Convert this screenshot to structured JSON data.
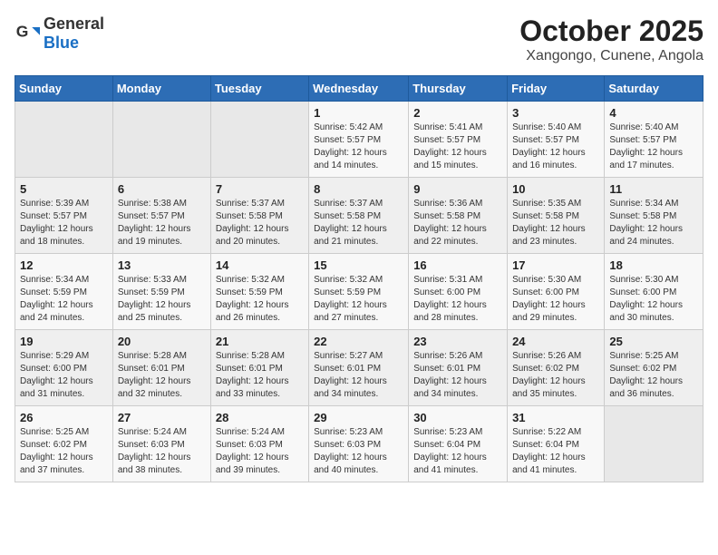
{
  "logo": {
    "general": "General",
    "blue": "Blue"
  },
  "title": {
    "month": "October 2025",
    "location": "Xangongo, Cunene, Angola"
  },
  "weekdays": [
    "Sunday",
    "Monday",
    "Tuesday",
    "Wednesday",
    "Thursday",
    "Friday",
    "Saturday"
  ],
  "weeks": [
    [
      {
        "day": "",
        "info": ""
      },
      {
        "day": "",
        "info": ""
      },
      {
        "day": "",
        "info": ""
      },
      {
        "day": "1",
        "info": "Sunrise: 5:42 AM\nSunset: 5:57 PM\nDaylight: 12 hours\nand 14 minutes."
      },
      {
        "day": "2",
        "info": "Sunrise: 5:41 AM\nSunset: 5:57 PM\nDaylight: 12 hours\nand 15 minutes."
      },
      {
        "day": "3",
        "info": "Sunrise: 5:40 AM\nSunset: 5:57 PM\nDaylight: 12 hours\nand 16 minutes."
      },
      {
        "day": "4",
        "info": "Sunrise: 5:40 AM\nSunset: 5:57 PM\nDaylight: 12 hours\nand 17 minutes."
      }
    ],
    [
      {
        "day": "5",
        "info": "Sunrise: 5:39 AM\nSunset: 5:57 PM\nDaylight: 12 hours\nand 18 minutes."
      },
      {
        "day": "6",
        "info": "Sunrise: 5:38 AM\nSunset: 5:57 PM\nDaylight: 12 hours\nand 19 minutes."
      },
      {
        "day": "7",
        "info": "Sunrise: 5:37 AM\nSunset: 5:58 PM\nDaylight: 12 hours\nand 20 minutes."
      },
      {
        "day": "8",
        "info": "Sunrise: 5:37 AM\nSunset: 5:58 PM\nDaylight: 12 hours\nand 21 minutes."
      },
      {
        "day": "9",
        "info": "Sunrise: 5:36 AM\nSunset: 5:58 PM\nDaylight: 12 hours\nand 22 minutes."
      },
      {
        "day": "10",
        "info": "Sunrise: 5:35 AM\nSunset: 5:58 PM\nDaylight: 12 hours\nand 23 minutes."
      },
      {
        "day": "11",
        "info": "Sunrise: 5:34 AM\nSunset: 5:58 PM\nDaylight: 12 hours\nand 24 minutes."
      }
    ],
    [
      {
        "day": "12",
        "info": "Sunrise: 5:34 AM\nSunset: 5:59 PM\nDaylight: 12 hours\nand 24 minutes."
      },
      {
        "day": "13",
        "info": "Sunrise: 5:33 AM\nSunset: 5:59 PM\nDaylight: 12 hours\nand 25 minutes."
      },
      {
        "day": "14",
        "info": "Sunrise: 5:32 AM\nSunset: 5:59 PM\nDaylight: 12 hours\nand 26 minutes."
      },
      {
        "day": "15",
        "info": "Sunrise: 5:32 AM\nSunset: 5:59 PM\nDaylight: 12 hours\nand 27 minutes."
      },
      {
        "day": "16",
        "info": "Sunrise: 5:31 AM\nSunset: 6:00 PM\nDaylight: 12 hours\nand 28 minutes."
      },
      {
        "day": "17",
        "info": "Sunrise: 5:30 AM\nSunset: 6:00 PM\nDaylight: 12 hours\nand 29 minutes."
      },
      {
        "day": "18",
        "info": "Sunrise: 5:30 AM\nSunset: 6:00 PM\nDaylight: 12 hours\nand 30 minutes."
      }
    ],
    [
      {
        "day": "19",
        "info": "Sunrise: 5:29 AM\nSunset: 6:00 PM\nDaylight: 12 hours\nand 31 minutes."
      },
      {
        "day": "20",
        "info": "Sunrise: 5:28 AM\nSunset: 6:01 PM\nDaylight: 12 hours\nand 32 minutes."
      },
      {
        "day": "21",
        "info": "Sunrise: 5:28 AM\nSunset: 6:01 PM\nDaylight: 12 hours\nand 33 minutes."
      },
      {
        "day": "22",
        "info": "Sunrise: 5:27 AM\nSunset: 6:01 PM\nDaylight: 12 hours\nand 34 minutes."
      },
      {
        "day": "23",
        "info": "Sunrise: 5:26 AM\nSunset: 6:01 PM\nDaylight: 12 hours\nand 34 minutes."
      },
      {
        "day": "24",
        "info": "Sunrise: 5:26 AM\nSunset: 6:02 PM\nDaylight: 12 hours\nand 35 minutes."
      },
      {
        "day": "25",
        "info": "Sunrise: 5:25 AM\nSunset: 6:02 PM\nDaylight: 12 hours\nand 36 minutes."
      }
    ],
    [
      {
        "day": "26",
        "info": "Sunrise: 5:25 AM\nSunset: 6:02 PM\nDaylight: 12 hours\nand 37 minutes."
      },
      {
        "day": "27",
        "info": "Sunrise: 5:24 AM\nSunset: 6:03 PM\nDaylight: 12 hours\nand 38 minutes."
      },
      {
        "day": "28",
        "info": "Sunrise: 5:24 AM\nSunset: 6:03 PM\nDaylight: 12 hours\nand 39 minutes."
      },
      {
        "day": "29",
        "info": "Sunrise: 5:23 AM\nSunset: 6:03 PM\nDaylight: 12 hours\nand 40 minutes."
      },
      {
        "day": "30",
        "info": "Sunrise: 5:23 AM\nSunset: 6:04 PM\nDaylight: 12 hours\nand 41 minutes."
      },
      {
        "day": "31",
        "info": "Sunrise: 5:22 AM\nSunset: 6:04 PM\nDaylight: 12 hours\nand 41 minutes."
      },
      {
        "day": "",
        "info": ""
      }
    ]
  ]
}
